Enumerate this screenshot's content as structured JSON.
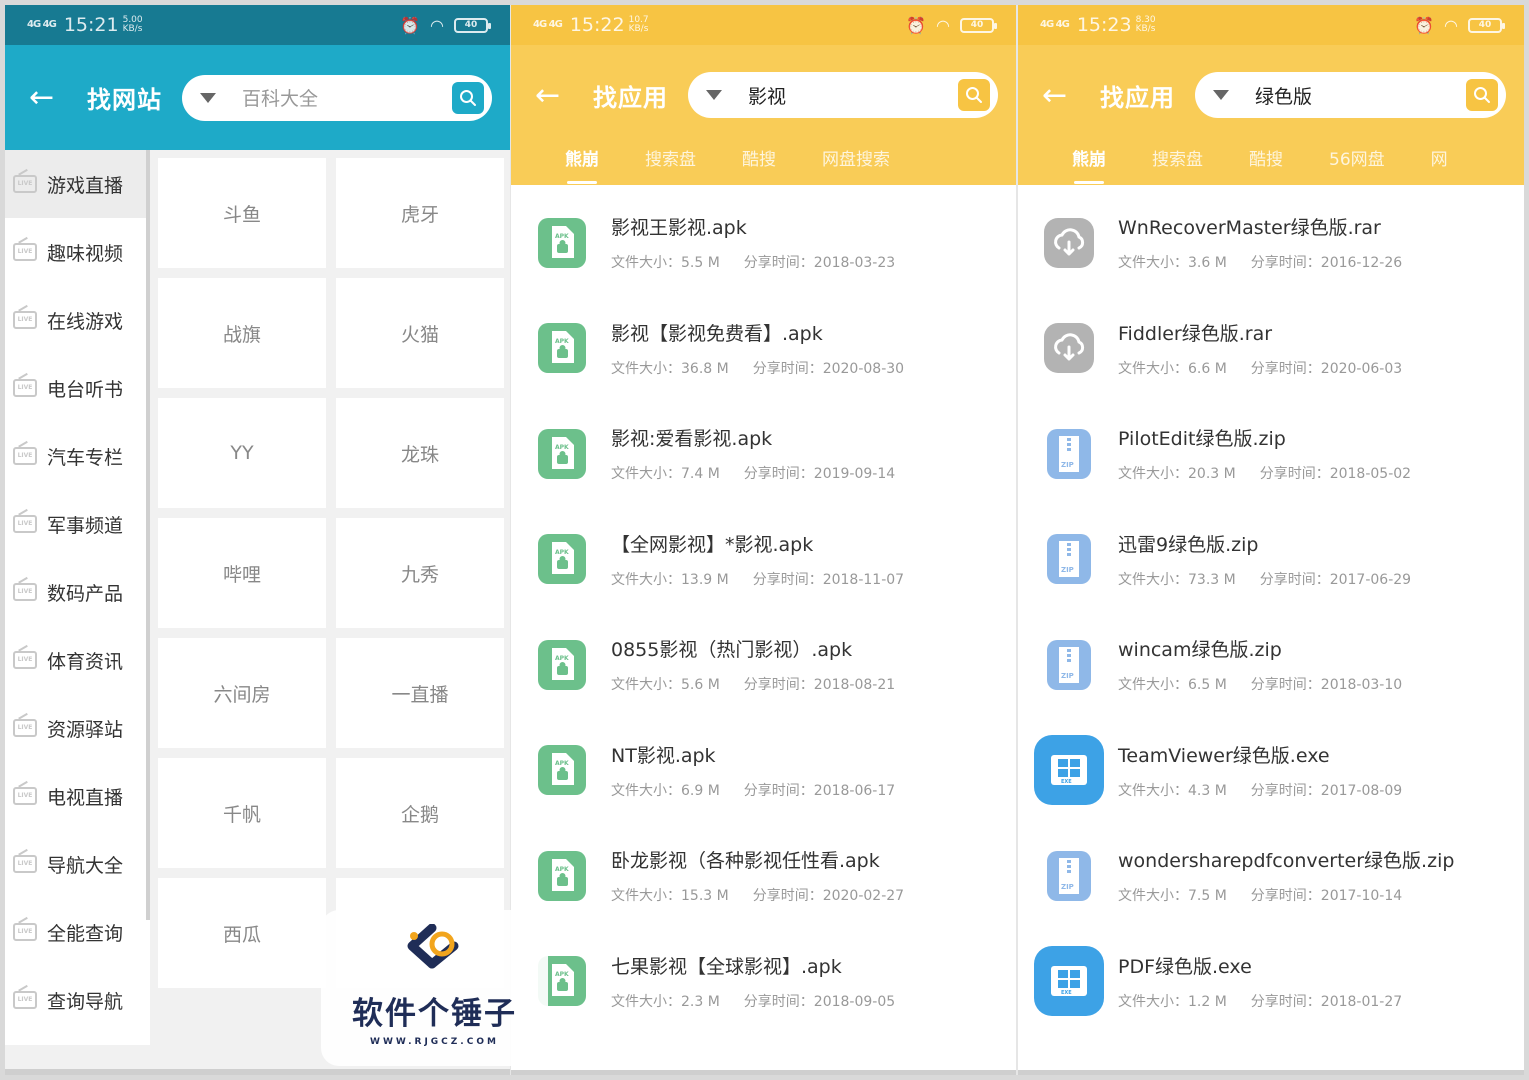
{
  "panels": {
    "p1": {
      "status": {
        "signal": "4G 4G",
        "time": "15:21",
        "speed": "5.00 KB/s",
        "battery": "40"
      },
      "title": "找网站",
      "search_placeholder": "百科大全",
      "categories": [
        "游戏直播",
        "趣味视频",
        "在线游戏",
        "电台听书",
        "汽车专栏",
        "军事频道",
        "数码产品",
        "体育资讯",
        "资源驿站",
        "电视直播",
        "导航大全",
        "全能查询",
        "查询导航"
      ],
      "sites": [
        "斗鱼",
        "虎牙",
        "战旗",
        "火猫",
        "YY",
        "龙珠",
        "哔哩",
        "九秀",
        "六间房",
        "一直播",
        "千帆",
        "企鹅",
        "西瓜",
        ""
      ]
    },
    "p2": {
      "status": {
        "signal": "4G 4G",
        "time": "15:22",
        "speed": "10.7 KB/s",
        "battery": "40"
      },
      "title": "找应用",
      "search_value": "影视",
      "tabs": [
        "熊崩",
        "搜索盘",
        "酷搜",
        "网盘搜索"
      ],
      "files": [
        {
          "name": "影视王影视.apk",
          "size": "文件大小：5.5 M",
          "time": "分享时间：2018-03-23",
          "icon": "apk-icon"
        },
        {
          "name": "影视【影视免费看】.apk",
          "size": "文件大小：36.8 M",
          "time": "分享时间：2020-08-30",
          "icon": "apk-icon"
        },
        {
          "name": "影视:爱看影视.apk",
          "size": "文件大小：7.4 M",
          "time": "分享时间：2019-09-14",
          "icon": "apk-icon"
        },
        {
          "name": "【全网影视】*影视.apk",
          "size": "文件大小：13.9 M",
          "time": "分享时间：2018-11-07",
          "icon": "apk-icon"
        },
        {
          "name": "0855影视（热门影视）.apk",
          "size": "文件大小：5.6 M",
          "time": "分享时间：2018-08-21",
          "icon": "apk-icon"
        },
        {
          "name": "NT影视.apk",
          "size": "文件大小：6.9 M",
          "time": "分享时间：2018-06-17",
          "icon": "apk-icon"
        },
        {
          "name": "卧龙影视（各种影视任性看.apk",
          "size": "文件大小：15.3 M",
          "time": "分享时间：2020-02-27",
          "icon": "apk-icon"
        },
        {
          "name": "七果影视【全球影视】.apk",
          "size": "文件大小：2.3 M",
          "time": "分享时间：2018-09-05",
          "icon": "apk-icon"
        }
      ]
    },
    "p3": {
      "status": {
        "signal": "4G 4G",
        "time": "15:23",
        "speed": "8.30 KB/s",
        "battery": "40"
      },
      "title": "找应用",
      "search_value": "绿色版",
      "tabs": [
        "熊崩",
        "搜索盘",
        "酷搜",
        "56网盘",
        "网"
      ],
      "files": [
        {
          "name": "WnRecoverMaster绿色版.rar",
          "size": "文件大小：3.6 M",
          "time": "分享时间：2016-12-26",
          "icon": "cloud-icon"
        },
        {
          "name": "Fiddler绿色版.rar",
          "size": "文件大小：6.6 M",
          "time": "分享时间：2020-06-03",
          "icon": "cloud-icon"
        },
        {
          "name": "PilotEdit绿色版.zip",
          "size": "文件大小：20.3 M",
          "time": "分享时间：2018-05-02",
          "icon": "zip-icon"
        },
        {
          "name": "迅雷9绿色版.zip",
          "size": "文件大小：73.3 M",
          "time": "分享时间：2017-06-29",
          "icon": "zip-icon"
        },
        {
          "name": "wincam绿色版.zip",
          "size": "文件大小：6.5 M",
          "time": "分享时间：2018-03-10",
          "icon": "zip-icon"
        },
        {
          "name": "TeamViewer绿色版.exe",
          "size": "文件大小：4.3 M",
          "time": "分享时间：2017-08-09",
          "icon": "exe-icon"
        },
        {
          "name": "wondersharepdfconverter绿色版.zip",
          "size": "文件大小：7.5 M",
          "time": "分享时间：2017-10-14",
          "icon": "zip-icon"
        },
        {
          "name": "PDF绿色版.exe",
          "size": "文件大小：1.2 M",
          "time": "分享时间：2018-01-27",
          "icon": "exe-icon"
        }
      ]
    }
  },
  "watermark": {
    "brand": "软件个锤子",
    "url": "WWW.RJGCZ.COM"
  },
  "colors": {
    "teal_dark": "#177a92",
    "teal": "#1eaac8",
    "yellow": "#f9cc57",
    "apk_green": "#6cc08b",
    "zip_blue": "#8fb8e8",
    "exe_blue": "#3da2e6",
    "cloud_grey": "#b3b3b3"
  }
}
